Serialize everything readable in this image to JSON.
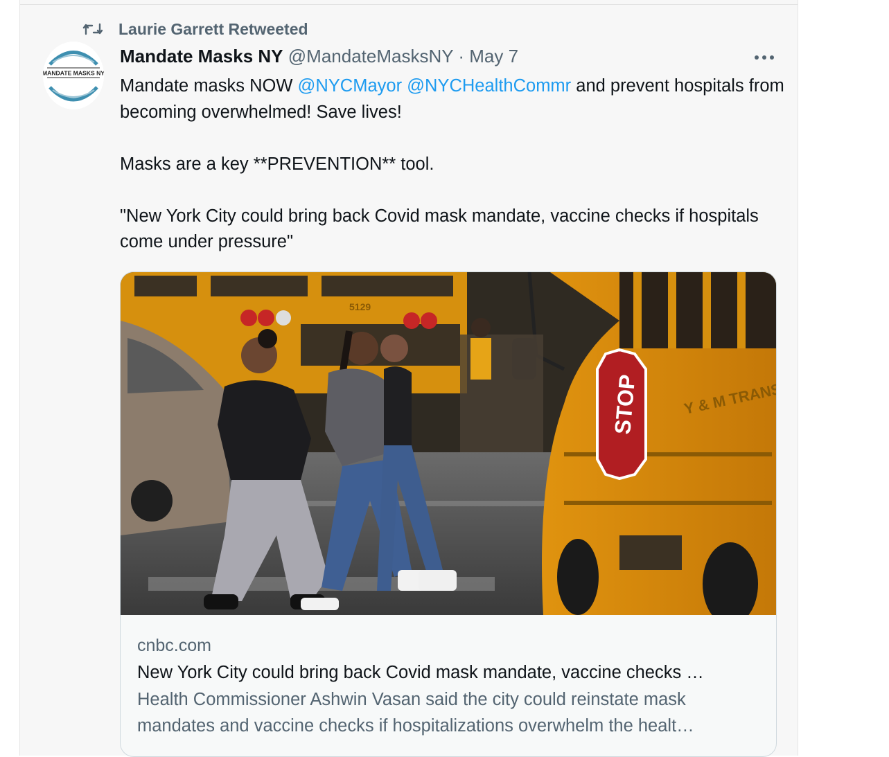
{
  "retweet": {
    "icon": "retweet-icon",
    "text": "Laurie Garrett Retweeted"
  },
  "author": {
    "avatar_text": "MANDATE MASKS NY",
    "name": "Mandate Masks NY",
    "handle": "@MandateMasksNY",
    "separator": "·",
    "date": "May 7"
  },
  "more_icon": "more-horizontal-icon",
  "tweet": {
    "line1_pre": "Mandate masks NOW ",
    "mention1": "@NYCMayor",
    "mention2": "@NYCHealthCommr",
    "line1_post": " and prevent hospitals from becoming overwhelmed! Save lives!",
    "paragraph2": "Masks are a key **PREVENTION** tool.",
    "paragraph3": "\"New York City could bring back Covid mask mandate, vaccine checks if hospitals come under pressure\""
  },
  "link_card": {
    "image_signs": {
      "stop": "STOP",
      "bus_number": "5129",
      "bus_side": "Y & M TRANSIT CORP"
    },
    "domain": "cnbc.com",
    "title": "New York City could bring back Covid mask mandate, vaccine checks …",
    "description": "Health Commissioner Ashwin Vasan said the city could reinstate mask mandates and vaccine checks if hospitalizations overwhelm the healt…"
  },
  "colors": {
    "link": "#1d9bf0",
    "secondary": "#536471",
    "text": "#0f1419",
    "avatar_ring": "#3e8fb0"
  }
}
